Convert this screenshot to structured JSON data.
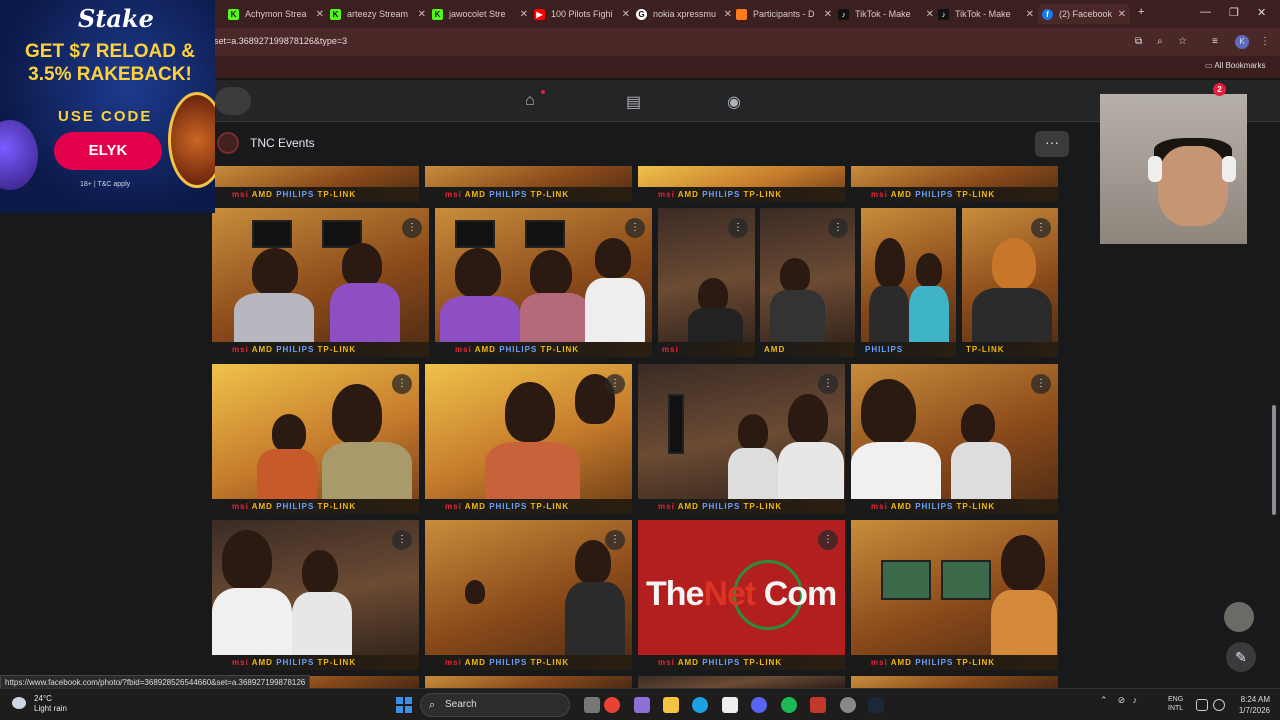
{
  "browser": {
    "tabs": [
      {
        "label": "Achymon Strea",
        "favicon": "kick-icon",
        "color": "#53fc18"
      },
      {
        "label": "arteezy Stream",
        "favicon": "kick-icon",
        "color": "#53fc18"
      },
      {
        "label": "jawocolet Stre",
        "favicon": "kick-icon",
        "color": "#53fc18"
      },
      {
        "label": "100 Pilots Fighi",
        "favicon": "youtube-icon",
        "color": "#ff0000"
      },
      {
        "label": "nokia xpressmu",
        "favicon": "google-icon",
        "color": "#ffffff"
      },
      {
        "label": "Participants - D",
        "favicon": "challonge-icon",
        "color": "#ff7a1a"
      },
      {
        "label": "TikTok - Make",
        "favicon": "tiktok-icon",
        "color": "#111111"
      },
      {
        "label": "TikTok - Make",
        "favicon": "tiktok-icon",
        "color": "#111111"
      },
      {
        "label": "(2) Facebook",
        "favicon": "facebook-icon",
        "color": "#1877f2"
      }
    ],
    "new_tab": "+",
    "url": "set=a.368927199878126&type=3",
    "bookmarks_label": "All Bookmarks",
    "profile_initial": "K"
  },
  "facebook": {
    "notifications_count": "2",
    "album_title": "TNC Events",
    "more_label": "···",
    "photo_overlay_text": "tnc",
    "sponsor_strip": {
      "msi": "msi",
      "amd": "AMD",
      "philips": "PHILIPS",
      "tplink": "TP-LINK"
    },
    "logo_photo": {
      "the": "The",
      "net": "Net",
      "com": " Com"
    }
  },
  "ad": {
    "brand": "Stake",
    "headline": "GET $7 RELOAD & 3.5% RAKEBACK!",
    "code_label": "USE CODE",
    "code": "ELYK",
    "terms": "18+ | T&C apply"
  },
  "status_link": "https://www.facebook.com/photo/?fbid=368928526544660&set=a.368927199878126",
  "taskbar": {
    "temperature": "24°C",
    "weather": "Light rain",
    "search_placeholder": "Search",
    "lang_top": "ENG",
    "lang_bottom": "INTL",
    "time": "8:24 AM",
    "date": "1/7/2026"
  }
}
